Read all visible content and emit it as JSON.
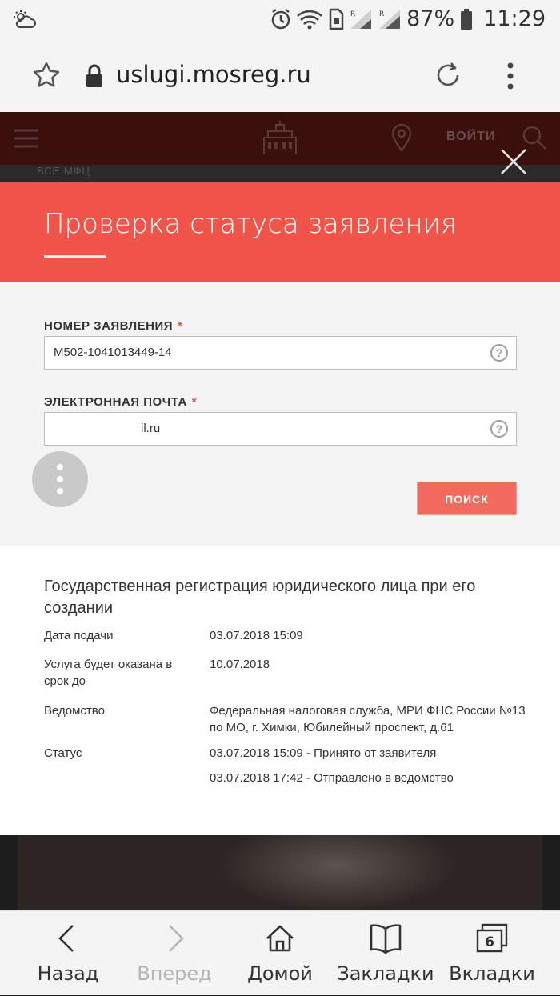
{
  "status_bar": {
    "battery": "87%",
    "time": "11:29"
  },
  "browser": {
    "url": "uslugi.mosreg.ru"
  },
  "site": {
    "login_label": "ВОЙТИ",
    "sub_label": "ВСЕ МФЦ"
  },
  "modal": {
    "title": "Проверка статуса заявления",
    "form": {
      "number_label": "НОМЕР ЗАЯВЛЕНИЯ",
      "number_value": "M502-1041013449-14",
      "email_label": "ЭЛЕКТРОННАЯ ПОЧТА",
      "email_value": "il.ru",
      "required_mark": "*",
      "help_mark": "?",
      "search_button": "ПОИСК"
    },
    "result": {
      "title": "Государственная регистрация юридического лица при его создании",
      "rows": [
        {
          "label": "Дата подачи",
          "value": "03.07.2018 15:09"
        },
        {
          "label": "Услуга будет оказана в срок до",
          "value": "10.07.2018"
        },
        {
          "label": "Ведомство",
          "value": "Федеральная налоговая служба, МРИ ФНС России №13 по МО, г. Химки, Юбилейный проспект, д.61"
        },
        {
          "label": "Статус",
          "value": "03.07.2018 15:09 - Принято от заявителя"
        }
      ],
      "status_extra": "03.07.2018 17:42 - Отправлено в ведомство"
    }
  },
  "bottom_nav": {
    "back": "Назад",
    "forward": "Вперед",
    "home": "Домой",
    "bookmarks": "Закладки",
    "tabs": "Вкладки",
    "tabs_count": "6"
  },
  "colors": {
    "modal_header": "#f15449",
    "search_button": "#f26a5d",
    "required": "#e24a3e"
  }
}
